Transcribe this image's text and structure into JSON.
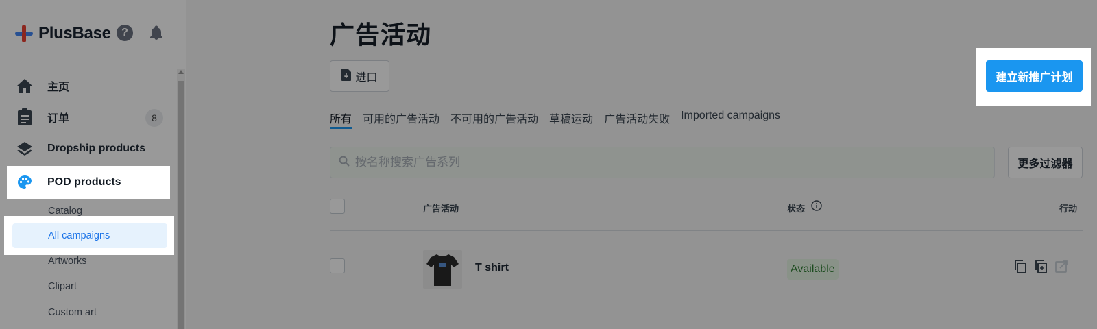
{
  "brand": {
    "name": "PlusBase"
  },
  "sidebar": {
    "items": [
      {
        "label": "主页",
        "icon": "home-icon"
      },
      {
        "label": "订单",
        "icon": "clipboard-icon",
        "badge": "8"
      },
      {
        "label": "Dropship products",
        "icon": "layers-icon"
      },
      {
        "label": "POD products",
        "icon": "palette-icon"
      }
    ],
    "sub_items": [
      {
        "label": "Catalog"
      },
      {
        "label": "All campaigns"
      },
      {
        "label": "Artworks"
      },
      {
        "label": "Clipart"
      },
      {
        "label": "Custom art"
      }
    ]
  },
  "main": {
    "title": "广告活动",
    "import_label": "进口",
    "create_label": "建立新推广计划",
    "tabs": [
      {
        "label": "所有"
      },
      {
        "label": "可用的广告活动"
      },
      {
        "label": "不可用的广告活动"
      },
      {
        "label": "草稿运动"
      },
      {
        "label": "广告活动失败"
      },
      {
        "label": "Imported campaigns"
      }
    ],
    "search": {
      "placeholder": "按名称搜索广告系列"
    },
    "filter_label": "更多过滤器",
    "table": {
      "columns": {
        "campaign": "广告活动",
        "status": "状态",
        "action": "行动"
      },
      "rows": [
        {
          "name": "T shirt",
          "status": "Available"
        }
      ]
    }
  },
  "colors": {
    "accent": "#1a96f0",
    "status_available_bg": "#e5f3e3",
    "status_available_text": "#2e7d32"
  }
}
